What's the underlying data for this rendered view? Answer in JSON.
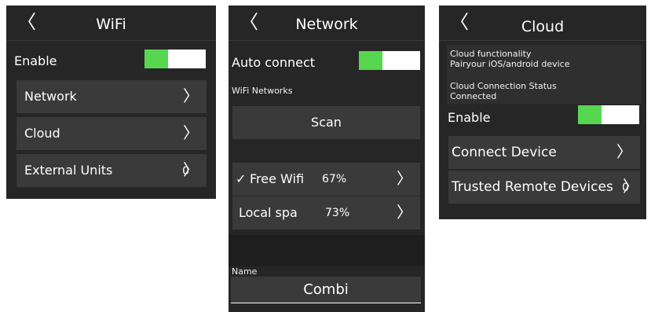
{
  "wifi_screen": {
    "back_label": "〈",
    "title": "WiFi",
    "enable_label": "Enable",
    "enable_on": true,
    "items": [
      {
        "label": "Network",
        "chevron": "〉",
        "count": ""
      },
      {
        "label": "Cloud",
        "chevron": "〉",
        "count": ""
      },
      {
        "label": "External Units",
        "chevron": "〉",
        "count": "0"
      }
    ]
  },
  "network_screen": {
    "back_label": "〈",
    "title": "Network",
    "auto_connect_label": "Auto connect",
    "auto_connect_on": true,
    "networks_heading": "WiFi Networks",
    "scan_label": "Scan",
    "networks": [
      {
        "check": "✓",
        "name": "Free Wifi",
        "signal": "67%",
        "chevron": "〉"
      },
      {
        "check": "",
        "name": "Local spa",
        "signal": "73%",
        "chevron": "〉"
      }
    ],
    "name_label": "Name",
    "name_value": "Combi"
  },
  "cloud_screen": {
    "back_label": "〈",
    "title": "Cloud",
    "functionality_title": "Cloud functionality",
    "functionality_desc": "Pairyour iOS/android device",
    "status_title": "Cloud Connection Status",
    "status_value": "Connected",
    "enable_label": "Enable",
    "enable_on": true,
    "items": [
      {
        "label": "Connect Device",
        "chevron": "〉",
        "count": ""
      },
      {
        "label": "Trusted Remote Devices",
        "chevron": "〉",
        "count": "0"
      }
    ]
  },
  "colors": {
    "background": "#262626",
    "item": "#3a3a3a",
    "toggle_on": "#57d64f",
    "toggle_off": "#ffffff"
  }
}
